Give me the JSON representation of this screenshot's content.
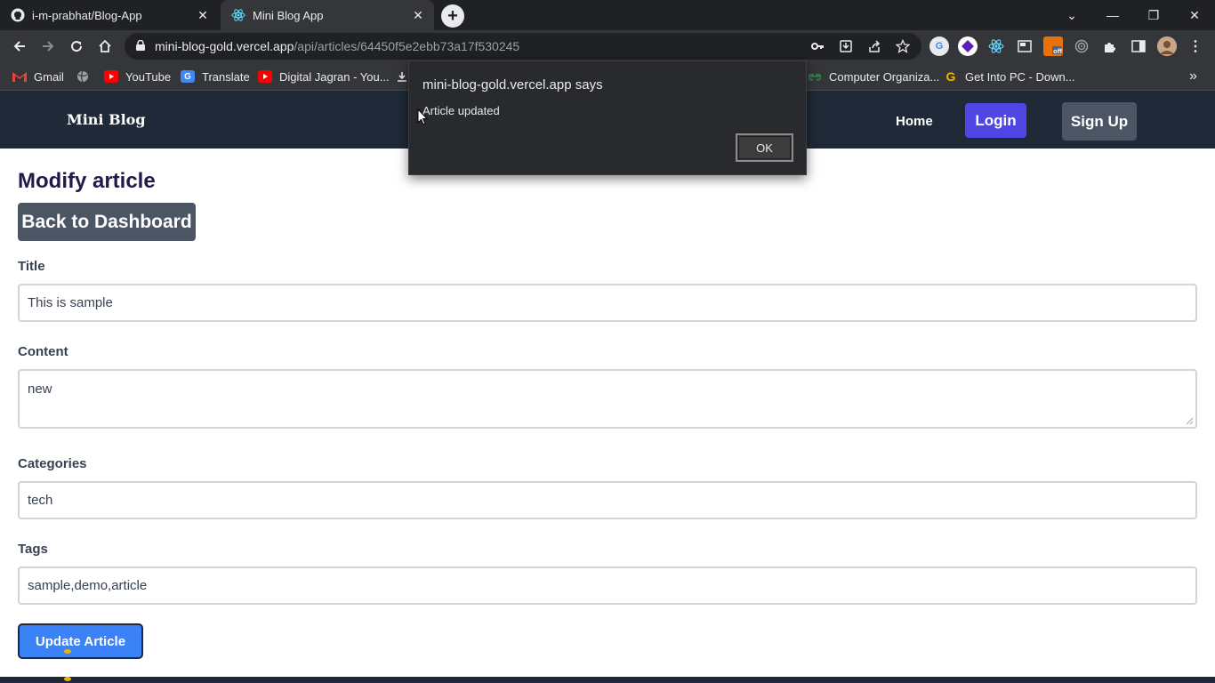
{
  "browser": {
    "tabs": [
      {
        "title": "i-m-prabhat/Blog-App",
        "icon": "github-icon",
        "active": false
      },
      {
        "title": "Mini Blog App",
        "icon": "react-icon",
        "active": true
      }
    ],
    "new_tab_label": "+",
    "window_controls": [
      "⌄",
      "—",
      "❐",
      "✕"
    ],
    "address": {
      "domain": "mini-blog-gold.vercel.app",
      "path": "/api/articles/64450f5e2ebb73a17f530245"
    },
    "bookmarks": [
      {
        "label": "Gmail",
        "icon": "gmail-icon",
        "color": "#ea4335"
      },
      {
        "label": "",
        "icon": "globe-icon",
        "color": "#9aa0a6"
      },
      {
        "label": "YouTube",
        "icon": "youtube-icon",
        "color": "#ff0000"
      },
      {
        "label": "Translate",
        "icon": "translate-icon",
        "color": "#4285f4"
      },
      {
        "label": "Digital Jagran - You...",
        "icon": "youtube-icon",
        "color": "#ff0000"
      },
      {
        "label": "Computer Organiza...",
        "icon": "gfg-icon",
        "color": "#2f8d46"
      },
      {
        "label": "Get Into PC - Down...",
        "icon": "g-icon",
        "color": "#f5b400"
      }
    ],
    "bookmarks_more": "»"
  },
  "nav": {
    "brand": "Mini Blog",
    "home": "Home",
    "login": "Login",
    "signup": "Sign Up"
  },
  "page": {
    "title": "Modify article",
    "back_button": "Back to Dashboard",
    "fields": {
      "title_label": "Title",
      "title_value": "This is sample",
      "content_label": "Content",
      "content_value": "new",
      "categories_label": "Categories",
      "categories_value": "tech",
      "tags_label": "Tags",
      "tags_value": "sample,demo,article"
    },
    "submit": "Update Article"
  },
  "dialog": {
    "title": "mini-blog-gold.vercel.app says",
    "message": "Article updated",
    "ok": "OK"
  },
  "colors": {
    "nav_bg": "#1f2937",
    "login_bg": "#4f46e5",
    "secondary_btn": "#4b5563",
    "primary_btn": "#3b82f6",
    "title_color": "#1e1b4b"
  }
}
